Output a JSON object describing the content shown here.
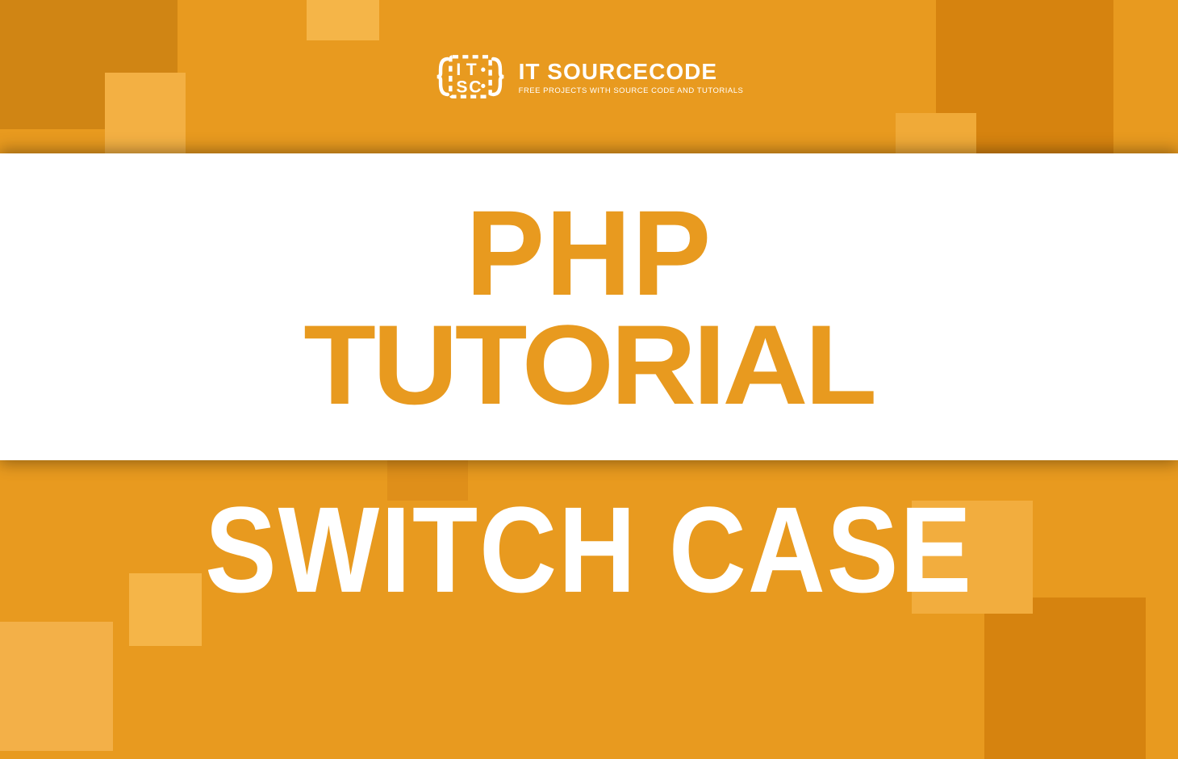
{
  "logo": {
    "title": "IT SOURCECODE",
    "tagline": "FREE PROJECTS WITH SOURCE CODE AND TUTORIALS"
  },
  "content": {
    "line1": "PHP",
    "line2": "TUTORIAL",
    "bottom": "SWITCH CASE"
  }
}
